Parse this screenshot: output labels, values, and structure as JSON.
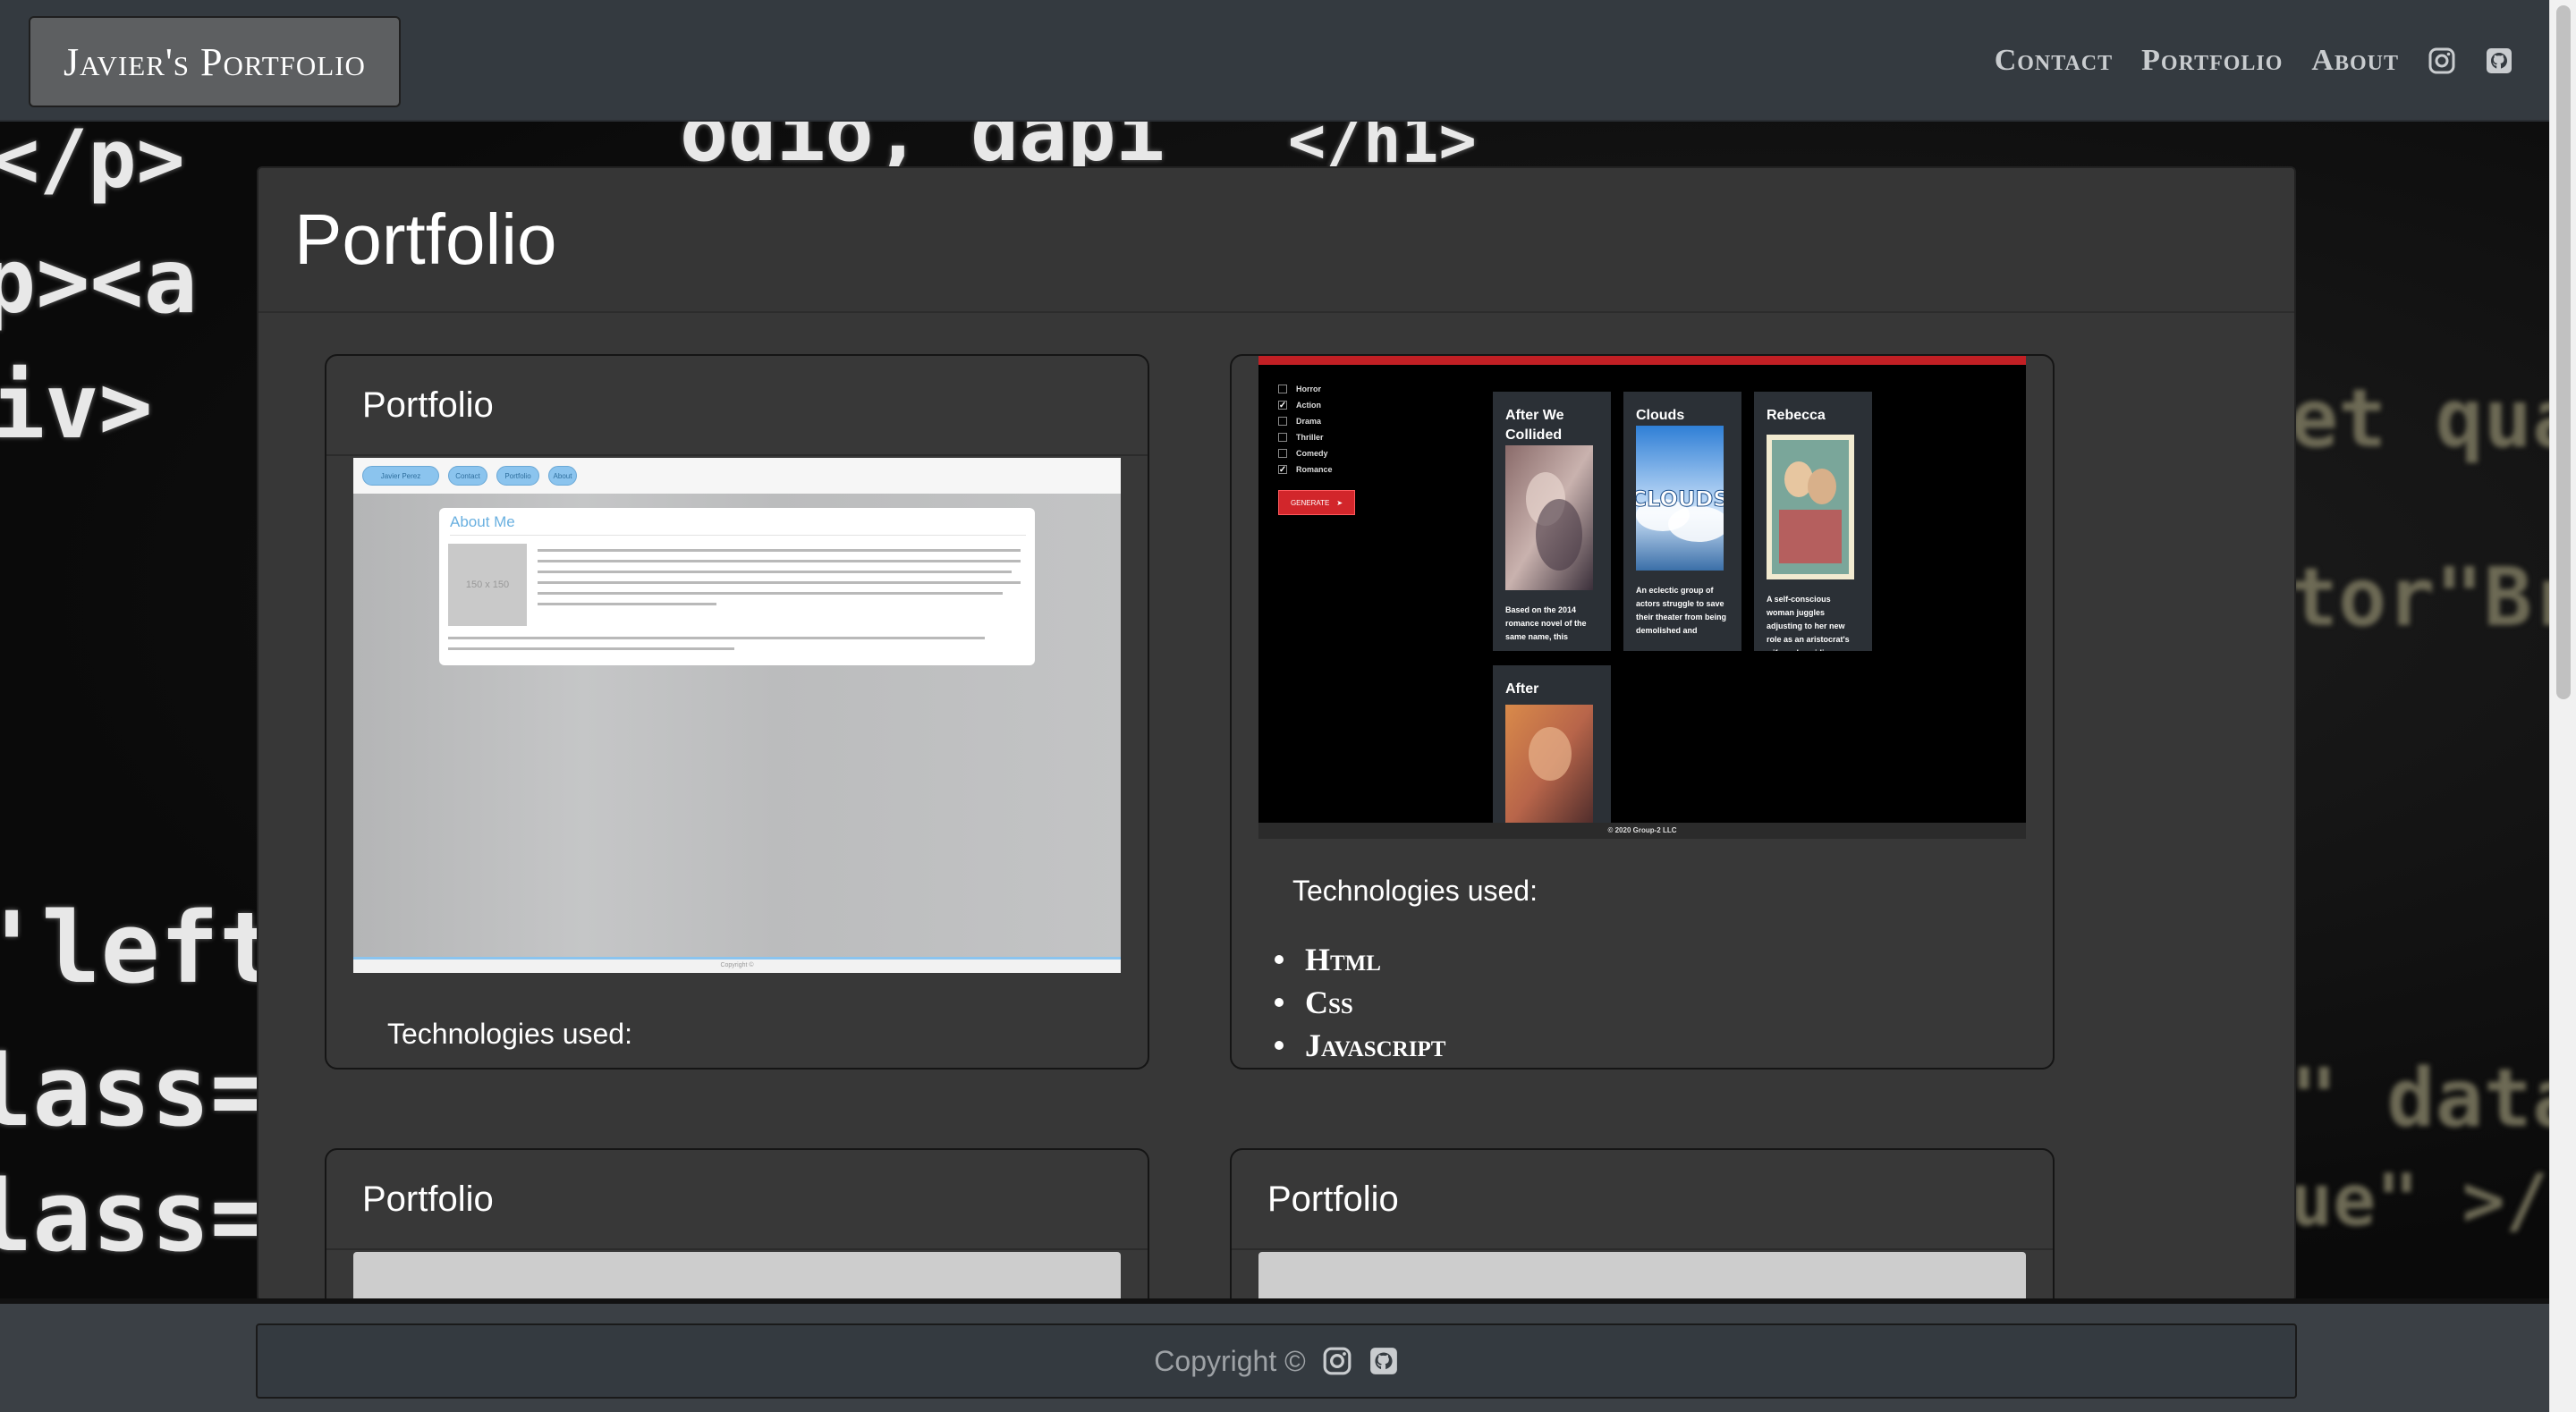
{
  "navbar": {
    "brand": "Javier's Portfolio",
    "links": [
      "Contact",
      "Portfolio",
      "About"
    ],
    "icons": [
      "instagram-icon",
      "github-icon"
    ]
  },
  "background": {
    "code_fragments": [
      "</p>",
      "odio, dapi",
      "\">",
      " </h1>",
      "p><a",
      "iv>",
      "'left",
      "lass=",
      "lass=",
      "et quam,",
      "tor\"Broad",
      "\" data-g",
      "ue\" >/s"
    ]
  },
  "main": {
    "title": "Portfolio",
    "cards": [
      {
        "header": "Portfolio",
        "screenshot": {
          "nav_pills": [
            "Javier Perez",
            "Contact",
            "Portfolio",
            "About"
          ],
          "card_title": "About Me",
          "thumb_label": "150 x 150",
          "footer": "Copyright ©"
        },
        "technologies_label": "Technologies used:",
        "technologies": []
      },
      {
        "header": "",
        "screenshot": {
          "genres": [
            {
              "name": "Horror",
              "checked": false
            },
            {
              "name": "Action",
              "checked": true
            },
            {
              "name": "Drama",
              "checked": false
            },
            {
              "name": "Thriller",
              "checked": false
            },
            {
              "name": "Comedy",
              "checked": false
            },
            {
              "name": "Romance",
              "checked": true
            }
          ],
          "generate_button": "GENERATE",
          "movies": [
            {
              "title": "After We Collided",
              "desc": "Based on the 2014 romance novel of the same name, this"
            },
            {
              "title": "Clouds",
              "desc": "An eclectic group of actors struggle to save their theater from being demolished and"
            },
            {
              "title": "Rebecca",
              "desc": "A self-conscious woman juggles adjusting to her new role as an aristocrat's wife and avoiding"
            },
            {
              "title": "After",
              "desc": ""
            }
          ],
          "poster_text_clouds": "CLOUDS",
          "footer": "© 2020 Group-2 LLC"
        },
        "technologies_label": "Technologies used:",
        "technologies": [
          "Html",
          "Css",
          "Javascript"
        ]
      },
      {
        "header": "Portfolio"
      },
      {
        "header": "Portfolio"
      }
    ]
  },
  "footer": {
    "copyright": "Copyright ©",
    "icons": [
      "instagram-icon",
      "github-icon"
    ]
  },
  "colors": {
    "navbar": "#343a40",
    "panel": "#373737",
    "accent_red": "#c21f24",
    "accent_blue": "#8bc4ee"
  }
}
